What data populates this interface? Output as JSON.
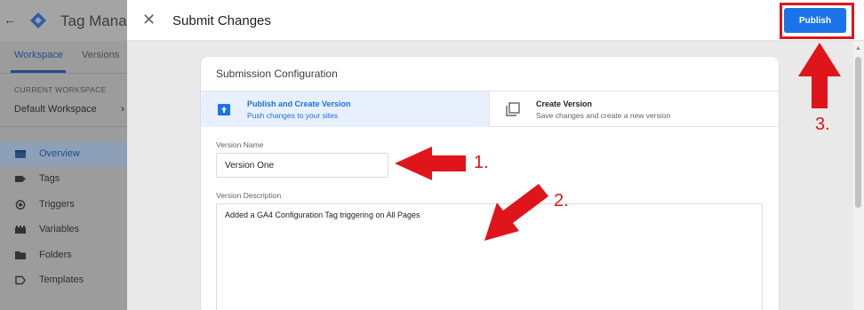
{
  "background_app": {
    "back_icon": "arrow-left-icon",
    "logo_icon": "gtm-diamond-logo",
    "title": "Tag Manage",
    "tabs": [
      {
        "label": "Workspace"
      },
      {
        "label": "Versions"
      }
    ],
    "workspace_caption": "CURRENT WORKSPACE",
    "workspace_name": "Default Workspace",
    "workspace_chevron": "›",
    "nav": [
      {
        "label": "Overview",
        "icon": "overview-icon"
      },
      {
        "label": "Tags",
        "icon": "tag-icon"
      },
      {
        "label": "Triggers",
        "icon": "trigger-icon"
      },
      {
        "label": "Variables",
        "icon": "variables-icon"
      },
      {
        "label": "Folders",
        "icon": "folder-icon"
      },
      {
        "label": "Templates",
        "icon": "template-icon"
      }
    ]
  },
  "dialog": {
    "close_glyph": "✕",
    "title": "Submit Changes",
    "publish_label": "Publish",
    "card_title": "Submission Configuration",
    "options": [
      {
        "title": "Publish and Create Version",
        "subtitle": "Push changes to your sites",
        "icon": "publish-upload-icon"
      },
      {
        "title": "Create Version",
        "subtitle": "Save changes and create a new version",
        "icon": "copy-version-icon"
      }
    ],
    "version_name_label": "Version Name",
    "version_name_value": "Version One",
    "version_desc_label": "Version Description",
    "version_desc_value": "Added a GA4 Configuration Tag triggering on All Pages"
  },
  "annotations": {
    "step1": "1.",
    "step2": "2.",
    "step3": "3.",
    "color": "#e0151b"
  },
  "colors": {
    "primary": "#1a73e8",
    "selected_bg": "#e8f0fe",
    "overlay_gray": "#9c9c9c"
  }
}
